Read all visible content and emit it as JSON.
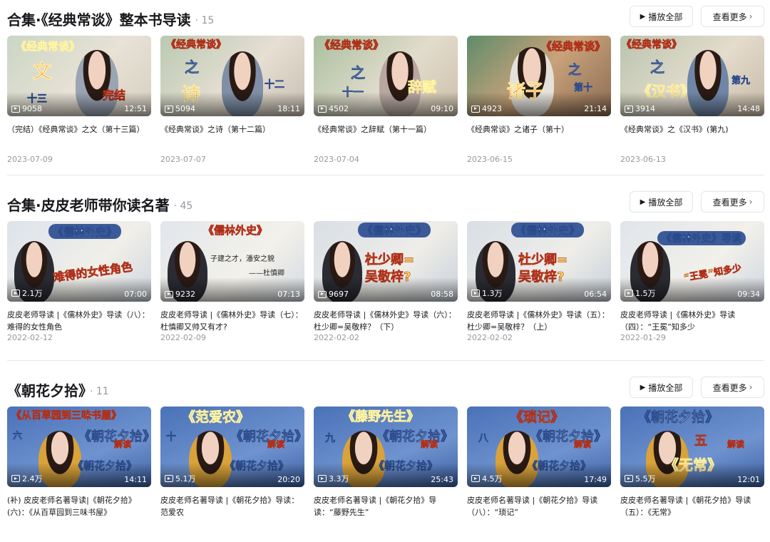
{
  "ui": {
    "play_all_label": "播放全部",
    "see_more_label": "查看更多",
    "play_icon": "play-triangle-icon",
    "chevron_icon": "chevron-right-icon"
  },
  "sections": [
    {
      "title": "合集·《经典常谈》整本书导读",
      "count": "· 15",
      "videos": [
        {
          "views": "9058",
          "duration": "12:51",
          "title": "（完结）《经典常谈》之文（第十三篇）",
          "date": "2023-07-09",
          "captions": [
            "《经典常谈》",
            "文",
            "十三",
            "完结"
          ]
        },
        {
          "views": "5094",
          "duration": "18:11",
          "title": "《经典常谈》之诗（第十二篇）",
          "date": "2023-07-07",
          "captions": [
            "《经典常谈》",
            "之",
            "诗",
            "十二"
          ]
        },
        {
          "views": "4502",
          "duration": "09:10",
          "title": "《经典常谈》之辞赋（第十一篇）",
          "date": "2023-07-04",
          "captions": [
            "《经典常谈》",
            "之",
            "十一",
            "辞赋"
          ]
        },
        {
          "views": "4923",
          "duration": "21:14",
          "title": "《经典常谈》之诸子（第十）",
          "date": "2023-06-15",
          "captions": [
            "《经典常谈》",
            "之",
            "诸子",
            "第十"
          ]
        },
        {
          "views": "3914",
          "duration": "14:48",
          "title": "《经典常谈》之《汉书》(第九)",
          "date": "2023-06-13",
          "captions": [
            "《经典常谈》",
            "之",
            "《汉书》",
            "第九"
          ]
        }
      ]
    },
    {
      "title": "合集·皮皮老师带你读名著",
      "count": "· 45",
      "videos": [
        {
          "views": "2.1万",
          "duration": "07:00",
          "title": "皮皮老师导读 |《儒林外史》导读（八）：难得的女性角色",
          "date": "2022-02-12",
          "captions": [
            "《儒林外史》",
            "难得的女性角色"
          ]
        },
        {
          "views": "9232",
          "duration": "07:13",
          "title": "皮皮老师导读 |《儒林外史》导读（七）：杜慎卿又帅又有才?",
          "date": "2022-02-09",
          "captions": [
            "《儒林外史》",
            "子建之才，潘安之貌",
            "——杜慎卿"
          ]
        },
        {
          "views": "9697",
          "duration": "08:58",
          "title": "皮皮老师导读 |《儒林外史》导读（六）：杜少卿=吴敬梓？（下）",
          "date": "2022-02-02",
          "captions": [
            "《儒林外史》",
            "杜少卿=",
            "吴敬梓?"
          ]
        },
        {
          "views": "1.3万",
          "duration": "06:54",
          "title": "皮皮老师导读 |《儒林外史》导读（五）：杜少卿=吴敬梓？（上）",
          "date": "2022-02-02",
          "captions": [
            "《儒林外史》",
            "杜少卿=",
            "吴敬梓?"
          ]
        },
        {
          "views": "1.5万",
          "duration": "09:34",
          "title": "皮皮老师导读 |《儒林外史》导读（四）：“王冕”知多少",
          "date": "2022-01-29",
          "captions": [
            "《儒林外史》导读",
            "“王冕”知多少"
          ]
        }
      ]
    },
    {
      "title": "《朝花夕拾》",
      "count": "· 11",
      "videos": [
        {
          "views": "2.4万",
          "duration": "14:11",
          "title": "(补) 皮皮老师名著导读|《朝花夕拾》(六)：《从百草园到三味书屋》",
          "captions": [
            "《从百草园到三味书屋》",
            "六",
            "《朝花夕拾》",
            "解读"
          ]
        },
        {
          "views": "5.1万",
          "duration": "20:20",
          "title": "皮皮老师名著导读 |《朝花夕拾》导读：范爱农",
          "captions": [
            "《范爱农》",
            "十",
            "《朝花夕拾》",
            "解读"
          ]
        },
        {
          "views": "3.3万",
          "duration": "25:43",
          "title": "皮皮老师名著导读 |《朝花夕拾》导读：“藤野先生”",
          "captions": [
            "《藤野先生》",
            "九",
            "《朝花夕拾》",
            "解读"
          ]
        },
        {
          "views": "4.5万",
          "duration": "17:49",
          "title": "皮皮老师名著导读 |《朝花夕拾》导读（八）：“琐记”",
          "captions": [
            "《琐记》",
            "八",
            "《朝花夕拾》",
            "解读"
          ]
        },
        {
          "views": "5.5万",
          "duration": "12:01",
          "title": "皮皮老师名著导读 |《朝花夕拾》导读（五）：《无常》",
          "captions": [
            "《朝花夕拾》",
            "五",
            "《无常》",
            "解读"
          ]
        }
      ]
    }
  ],
  "colors": {
    "text_primary": "#18191c",
    "text_secondary": "#9499a0",
    "border": "#e3e5e7"
  }
}
